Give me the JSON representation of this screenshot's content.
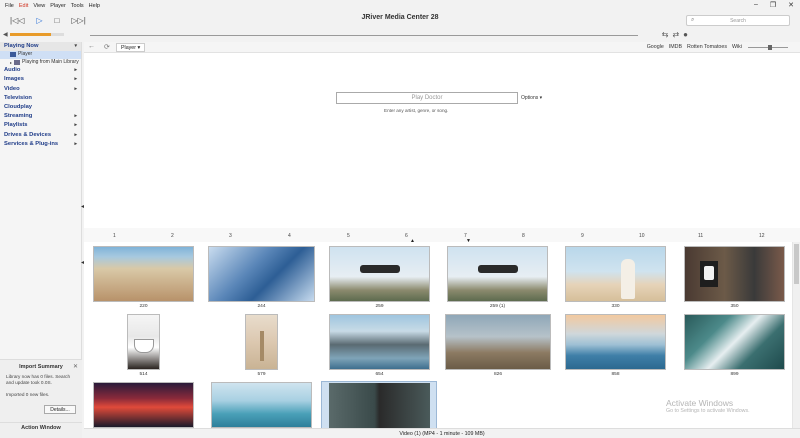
{
  "menu": [
    "File",
    "Edit",
    "View",
    "Player",
    "Tools",
    "Help"
  ],
  "menu_active": "Edit",
  "window": {
    "title": "JRiver Media Center 28",
    "controls": [
      "–",
      "❐",
      "✕"
    ]
  },
  "transport": {
    "prev": "|◁◁",
    "play": "▷",
    "stop": "□",
    "next": "▷▷|"
  },
  "search": {
    "placeholder": "Search"
  },
  "volume": {
    "level": 0.75,
    "accent": "#e89b2a"
  },
  "sidebar": {
    "items": [
      {
        "label": "Playing Now",
        "arrow": "▾"
      },
      {
        "label": "Audio",
        "arrow": "▸"
      },
      {
        "label": "Images",
        "arrow": "▸"
      },
      {
        "label": "Video",
        "arrow": "▸"
      },
      {
        "label": "Television",
        "arrow": ""
      },
      {
        "label": "Cloudplay",
        "arrow": ""
      },
      {
        "label": "Streaming",
        "arrow": "▸"
      },
      {
        "label": "Playlists",
        "arrow": "▸"
      },
      {
        "label": "Drives & Devices",
        "arrow": "▸"
      },
      {
        "label": "Services & Plug-ins",
        "arrow": "▸"
      }
    ],
    "sub": [
      {
        "label": "Player"
      },
      {
        "label": "Playing from Main Library"
      }
    ]
  },
  "import_panel": {
    "title": "Import Summary",
    "text": "Library now has 0 files. Search and update took 0.0S.",
    "imported": "Imported 0 new files.",
    "details_button": "Details...",
    "action_window": "Action Window"
  },
  "toolbar": {
    "tab": "Player ▾",
    "links": [
      "Google",
      "IMDB",
      "Rotten Tomatoes",
      "Wiki"
    ]
  },
  "player": {
    "input_placeholder": "Play Doctor",
    "options": "Options ▾",
    "hint": "Enter any artist, genre, or song."
  },
  "timeline": [
    "1",
    "2",
    "3",
    "4",
    "5",
    "6",
    "7",
    "8",
    "9",
    "10",
    "11",
    "12"
  ],
  "thumbnails": [
    {
      "caption": "220",
      "icon": "beach-shells-image"
    },
    {
      "caption": "244",
      "icon": "snowy-forest-image"
    },
    {
      "caption": "259",
      "icon": "drone-image"
    },
    {
      "caption": "259 (1)",
      "icon": "drone-image"
    },
    {
      "caption": "330",
      "icon": "people-beach-image"
    },
    {
      "caption": "350",
      "icon": "crosswalk-signal-image"
    },
    {
      "caption": "514",
      "icon": "coffee-cup-image"
    },
    {
      "caption": "579",
      "icon": "dried-flowers-image"
    },
    {
      "caption": "654",
      "icon": "mountain-lake-image"
    },
    {
      "caption": "826",
      "icon": "hiker-cliff-image"
    },
    {
      "caption": "858",
      "icon": "sunset-sea-image"
    },
    {
      "caption": "899",
      "icon": "aerial-waves-image"
    },
    {
      "caption": "",
      "icon": "red-sky-image"
    },
    {
      "caption": "",
      "icon": "ocean-horizon-image"
    },
    {
      "caption": "",
      "icon": "aerial-road-image"
    }
  ],
  "status": "Video (1) (MP4 - 1 minute - 109 MB)",
  "watermark": {
    "line1": "Activate Windows",
    "line2": "Go to Settings to activate Windows."
  }
}
